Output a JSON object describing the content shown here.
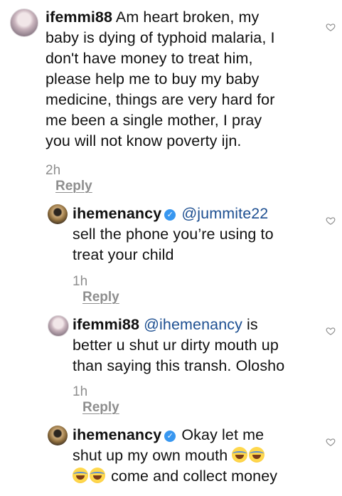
{
  "comments": [
    {
      "username": "ifemmi88",
      "text_lines": [
        "Am heart broken, my",
        "baby is dying of typhoid malaria, I",
        "don't have money to treat him,",
        "please help me to buy my baby",
        "medicine, things are very hard for",
        "me been a single mother, I pray",
        "you will not know poverty ijn."
      ],
      "time": "2h",
      "reply_label": "Reply"
    }
  ],
  "replies": [
    {
      "username": "ihemenancy",
      "mention": "@jummite22",
      "line2": "sell the phone you’re using to",
      "line3": "treat your child",
      "time": "1h",
      "reply_label": "Reply"
    },
    {
      "username": "ifemmi88",
      "mention": "@ihemenancy",
      "line1_rest": "is",
      "line2": "better u shut ur dirty mouth up",
      "line3": "than saying this transh. Olosho",
      "time": "1h",
      "reply_label": "Reply"
    },
    {
      "username": "ihemenancy",
      "line1_rest": "Okay let me",
      "line2": "shut up my own mouth",
      "line3": "come and collect money"
    }
  ],
  "icons": {
    "like": "heart-outline-icon",
    "verified": "verified-badge-icon",
    "emoji": "face-with-tears-of-joy-emoji"
  },
  "colors": {
    "mention": "#1d4f91",
    "meta": "#8e8e8e",
    "verified": "#3897f0"
  }
}
